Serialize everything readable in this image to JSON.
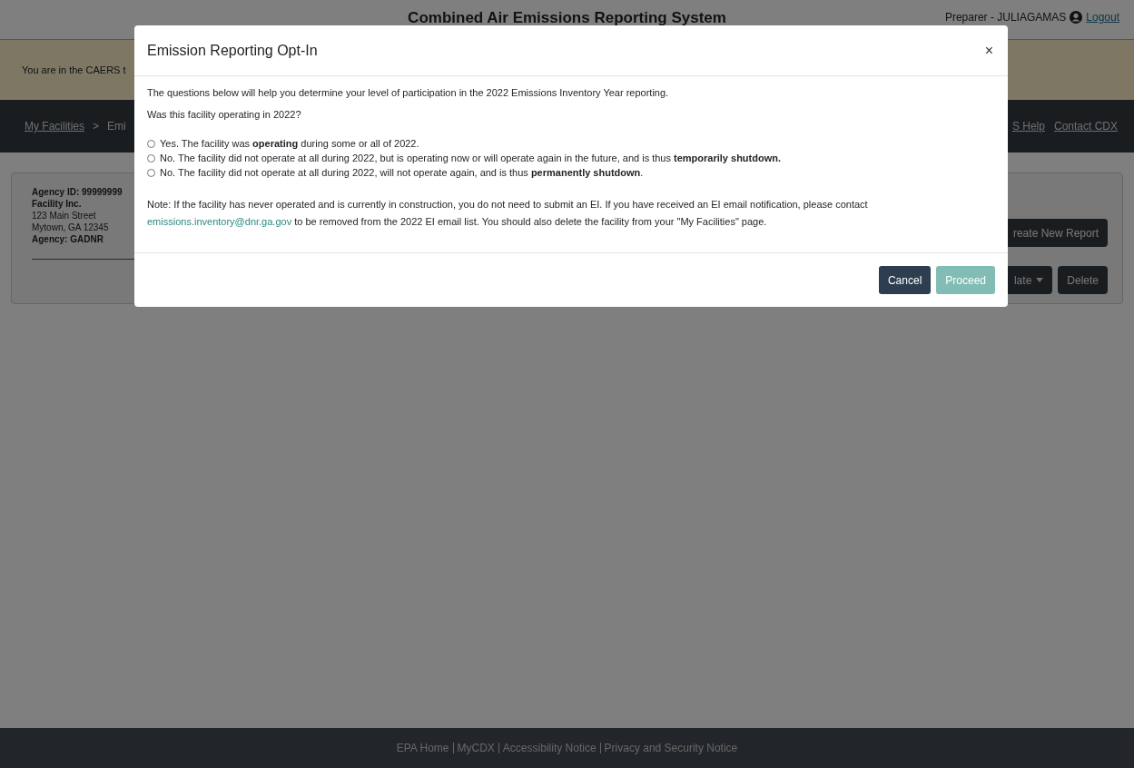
{
  "header": {
    "title": "Combined Air Emissions Reporting System",
    "user": "Preparer - JULIAGAMAS",
    "logout": "Logout"
  },
  "banner": {
    "text": "You are in the CAERS t"
  },
  "nav": {
    "breadcrumbs": [
      {
        "label": "My Facilities",
        "kind": "link"
      },
      {
        "label": ">",
        "kind": "separator"
      },
      {
        "label": "Emi",
        "kind": "text"
      }
    ],
    "links": [
      "S Help",
      "Contact CDX"
    ]
  },
  "facility": {
    "agency_id": "Agency ID: 99999999",
    "name": "Facility Inc.",
    "street": "123 Main Street",
    "city": "Mytown, GA 12345",
    "agency": "Agency: GADNR"
  },
  "actions": {
    "create": "reate New Report",
    "template": "late",
    "delete": "Delete"
  },
  "modal": {
    "title": "Emission Reporting Opt-In",
    "close": "×",
    "intro": "The questions below will help you determine your level of participation in the 2022 Emissions Inventory Year reporting.",
    "question": "Was this facility operating in 2022?",
    "options": [
      {
        "label": "Yes. The facility was **operating** during some or all of 2022.",
        "selected": false
      },
      {
        "label": "No. The facility did not operate at all during 2022, but is operating now or will operate again in the future, and is thus **temporarily shutdown.**",
        "selected": false
      },
      {
        "label": "No. The facility did not operate at all during 2022, will not operate again, and is thus **permanently shutdown**.",
        "selected": false
      }
    ],
    "note_before": "Note: If the facility has never operated and is currently in construction, you do not need to submit an EI. If you have received an EI email notification, please contact",
    "email": "emissions.inventory@dnr.ga.gov",
    "note_after": "to be removed from the 2022 EI email list. You should also delete the facility from your \"My Facilities\" page.",
    "buttons": [
      {
        "label": "Cancel",
        "disabled": false
      },
      {
        "label": "Proceed",
        "disabled": true
      }
    ]
  },
  "footer": [
    "EPA Home",
    "MyCDX",
    "Accessibility Notice",
    "Privacy and Security Notice"
  ]
}
